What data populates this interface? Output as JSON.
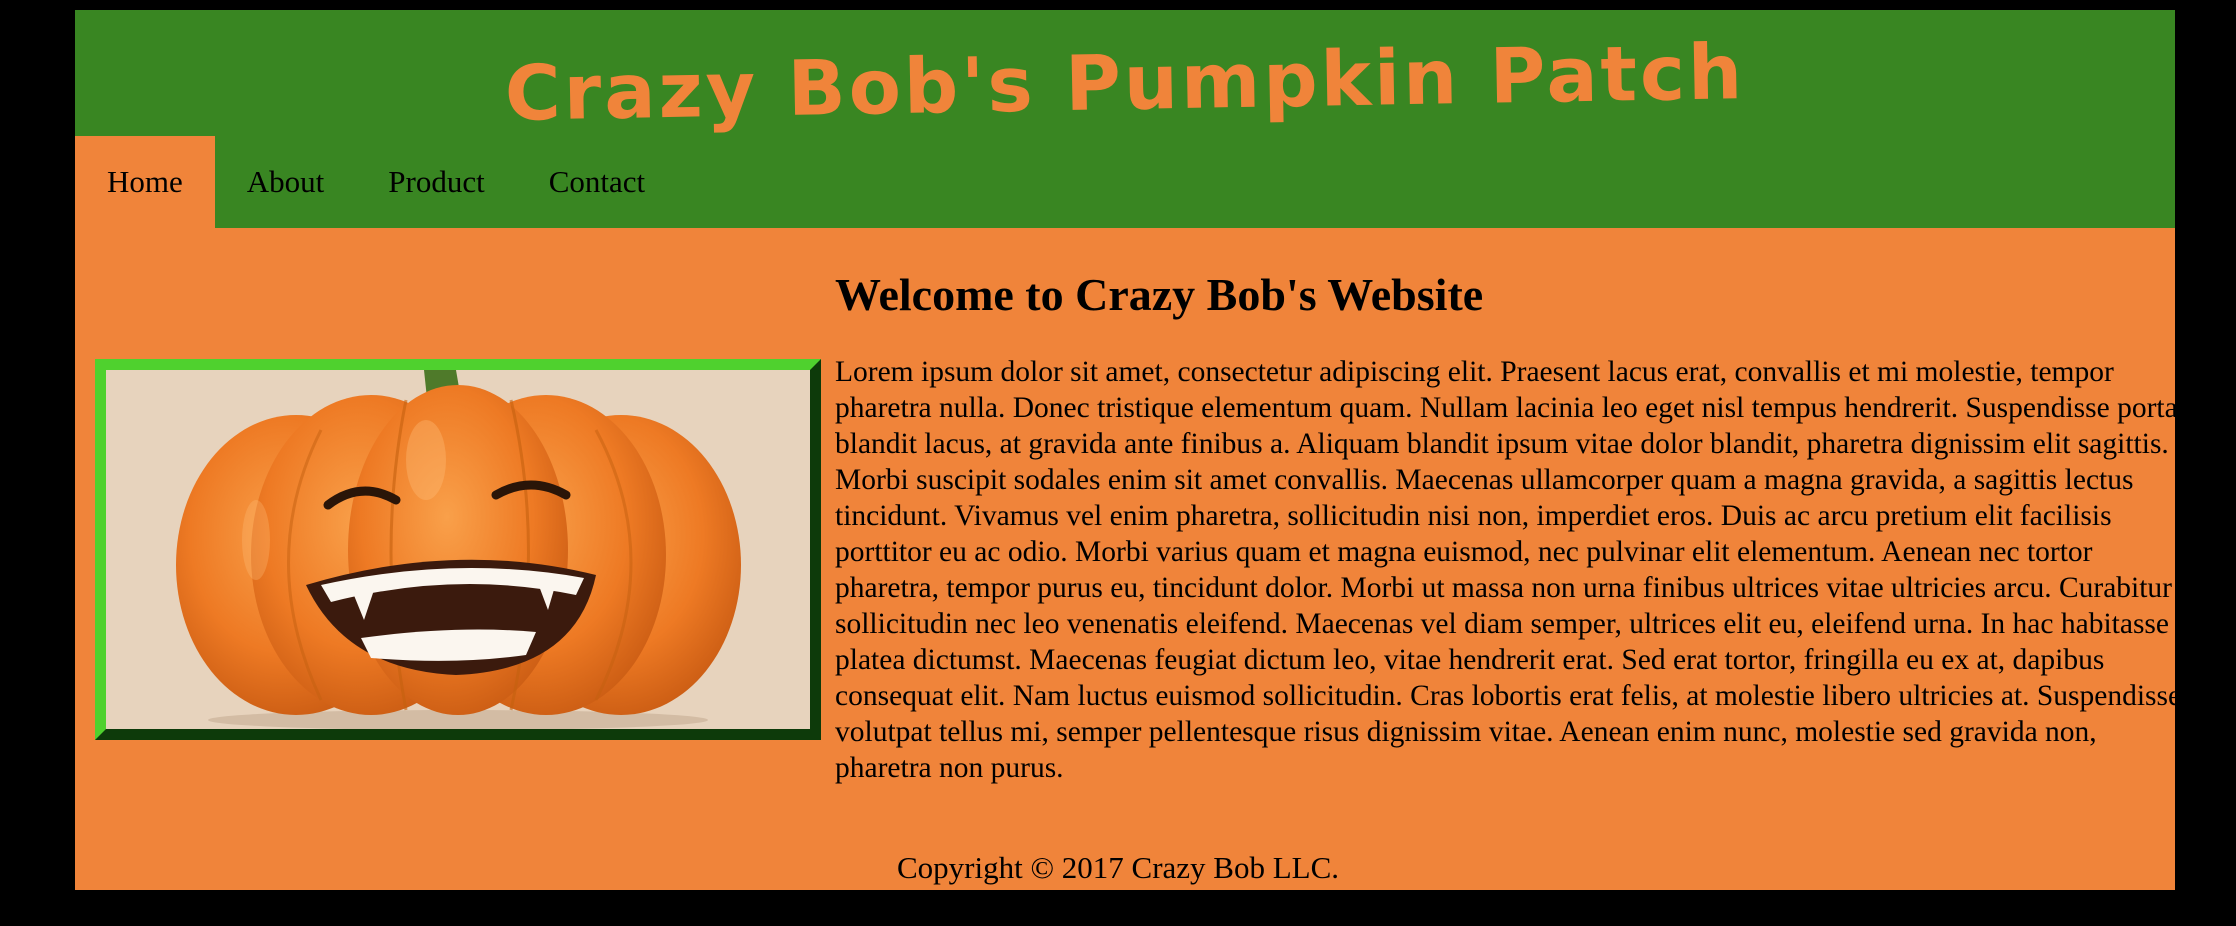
{
  "site": {
    "title": "Crazy Bob's Pumpkin Patch"
  },
  "nav": {
    "items": [
      {
        "label": "Home",
        "active": true
      },
      {
        "label": "About",
        "active": false
      },
      {
        "label": "Product",
        "active": false
      },
      {
        "label": "Contact",
        "active": false
      }
    ]
  },
  "main": {
    "image_icon": "smiling-pumpkin-photo",
    "heading": "Welcome to Crazy Bob's Website",
    "paragraph": "Lorem ipsum dolor sit amet, consectetur adipiscing elit. Praesent lacus erat, convallis et mi molestie, tempor pharetra nulla. Donec tristique elementum quam. Nullam lacinia leo eget nisl tempus hendrerit. Suspendisse porta blandit lacus, at gravida ante finibus a. Aliquam blandit ipsum vitae dolor blandit, pharetra dignissim elit sagittis. Morbi suscipit sodales enim sit amet convallis. Maecenas ullamcorper quam a magna gravida, a sagittis lectus tincidunt. Vivamus vel enim pharetra, sollicitudin nisi non, imperdiet eros. Duis ac arcu pretium elit facilisis porttitor eu ac odio. Morbi varius quam et magna euismod, nec pulvinar elit elementum. Aenean nec tortor pharetra, tempor purus eu, tincidunt dolor. Morbi ut massa non urna finibus ultrices vitae ultricies arcu. Curabitur sollicitudin nec leo venenatis eleifend. Maecenas vel diam semper, ultrices elit eu, eleifend urna. In hac habitasse platea dictumst. Maecenas feugiat dictum leo, vitae hendrerit erat. Sed erat tortor, fringilla eu ex at, dapibus consequat elit. Nam luctus euismod sollicitudin. Cras lobortis erat felis, at molestie libero ultricies at. Suspendisse volutpat tellus mi, semper pellentesque risus dignissim vitae. Aenean enim nunc, molestie sed gravida non, pharetra non purus."
  },
  "footer": {
    "copyright": "Copyright © 2017 Crazy Bob LLC."
  },
  "colors": {
    "page_background": "#000000",
    "header_green": "#398622",
    "accent_orange": "#f0843a",
    "frame_light": "#4fd12e",
    "frame_dark": "#0d3a0a"
  }
}
